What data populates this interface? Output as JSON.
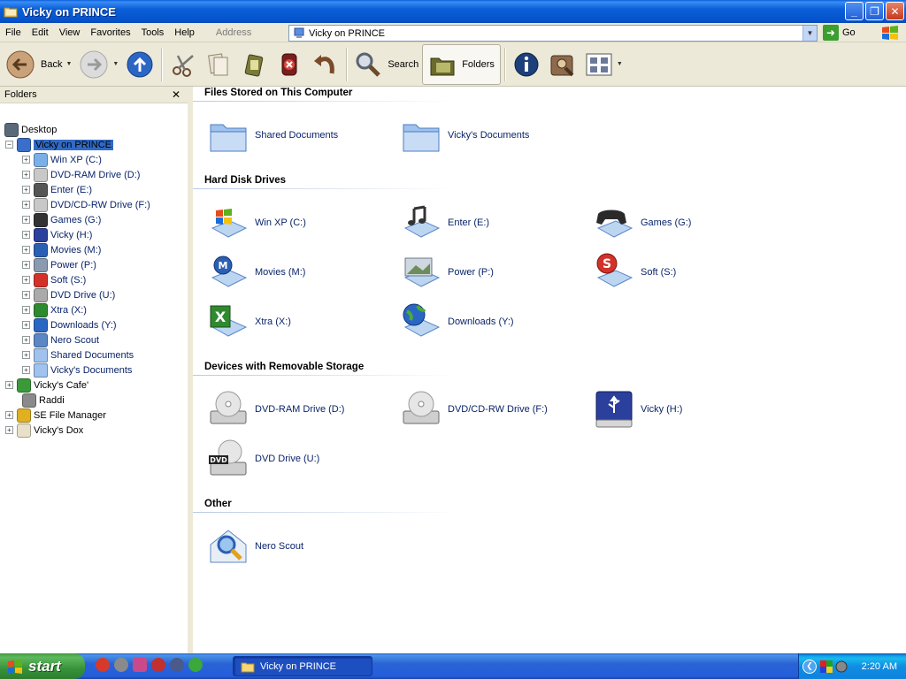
{
  "window": {
    "title": "Vicky on PRINCE"
  },
  "menu": [
    "File",
    "Edit",
    "View",
    "Favorites",
    "Tools",
    "Help"
  ],
  "address": {
    "label": "Address",
    "value": "Vicky on PRINCE",
    "go": "Go"
  },
  "toolbar": {
    "back": "Back",
    "search": "Search",
    "folders": "Folders"
  },
  "left_pane": {
    "header": "Folders",
    "tree": [
      {
        "label": "Desktop",
        "icon": "desktop-icon"
      },
      {
        "label": "Vicky on PRINCE",
        "icon": "computer-icon",
        "selected": true,
        "expanded": true
      },
      {
        "label": "Win XP (C:)",
        "icon": "winxp-drive-icon"
      },
      {
        "label": "DVD-RAM Drive (D:)",
        "icon": "optical-drive-icon"
      },
      {
        "label": "Enter (E:)",
        "icon": "music-drive-icon"
      },
      {
        "label": "DVD/CD-RW Drive (F:)",
        "icon": "optical-drive-icon"
      },
      {
        "label": "Games (G:)",
        "icon": "gamepad-drive-icon"
      },
      {
        "label": "Vicky (H:)",
        "icon": "usb-drive-icon"
      },
      {
        "label": "Movies (M:)",
        "icon": "movies-drive-icon"
      },
      {
        "label": "Power (P:)",
        "icon": "power-drive-icon"
      },
      {
        "label": "Soft (S:)",
        "icon": "soft-drive-icon"
      },
      {
        "label": "DVD Drive (U:)",
        "icon": "dvd-drive-icon"
      },
      {
        "label": "Xtra (X:)",
        "icon": "excel-drive-icon"
      },
      {
        "label": "Downloads (Y:)",
        "icon": "globe-drive-icon"
      },
      {
        "label": "Nero Scout",
        "icon": "nero-scout-icon"
      },
      {
        "label": "Shared Documents",
        "icon": "folder-icon"
      },
      {
        "label": "Vicky's Documents",
        "icon": "folder-icon"
      },
      {
        "label": "Vicky's Cafe'",
        "icon": "network-icon"
      },
      {
        "label": "Raddi",
        "icon": "recycle-bin-icon"
      },
      {
        "label": "SE File Manager",
        "icon": "file-manager-icon"
      },
      {
        "label": "Vicky's Dox",
        "icon": "notepad-icon"
      }
    ]
  },
  "groups": {
    "files": {
      "header": "Files Stored on This Computer",
      "items": [
        "Shared Documents",
        "Vicky's Documents"
      ]
    },
    "hdd": {
      "header": "Hard Disk Drives",
      "items": [
        "Win XP (C:)",
        "Enter (E:)",
        "Games (G:)",
        "Movies (M:)",
        "Power (P:)",
        "Soft (S:)",
        "Xtra (X:)",
        "Downloads (Y:)"
      ]
    },
    "removable": {
      "header": "Devices with Removable Storage",
      "items": [
        "DVD-RAM Drive (D:)",
        "DVD/CD-RW Drive (F:)",
        "Vicky (H:)",
        "DVD Drive (U:)"
      ]
    },
    "other": {
      "header": "Other",
      "items": [
        "Nero Scout"
      ]
    }
  },
  "taskbar": {
    "start": "start",
    "task": "Vicky on PRINCE",
    "clock": "2:20 AM"
  },
  "colors": {
    "titlebar": "#0553cc",
    "selection": "#316ac5",
    "link_text": "#0a246a",
    "start_green": "#37923a"
  }
}
